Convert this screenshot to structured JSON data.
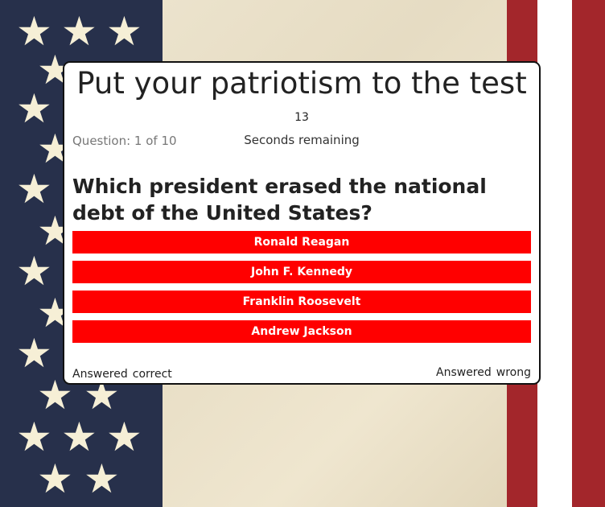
{
  "quiz": {
    "title": "Put your patriotism to the test",
    "timer": "13",
    "timer_label": "Seconds remaining",
    "question_count": "Question: 1 of 10",
    "question": "Which president erased the national debt of the United States?",
    "answers": [
      {
        "label": "Ronald Reagan"
      },
      {
        "label": "John F. Kennedy"
      },
      {
        "label": "Franklin Roosevelt"
      },
      {
        "label": "Andrew Jackson"
      }
    ],
    "answered_correct_label": "Answered",
    "correct_label": "correct",
    "answered_wrong_label": "Answered",
    "wrong_label": "wrong"
  },
  "colors": {
    "answer_bg": "#ff0000",
    "flag_blue": "#27304b",
    "flag_red": "#a3262b",
    "star": "#f6efd6"
  },
  "icons": [
    "star-icon"
  ]
}
